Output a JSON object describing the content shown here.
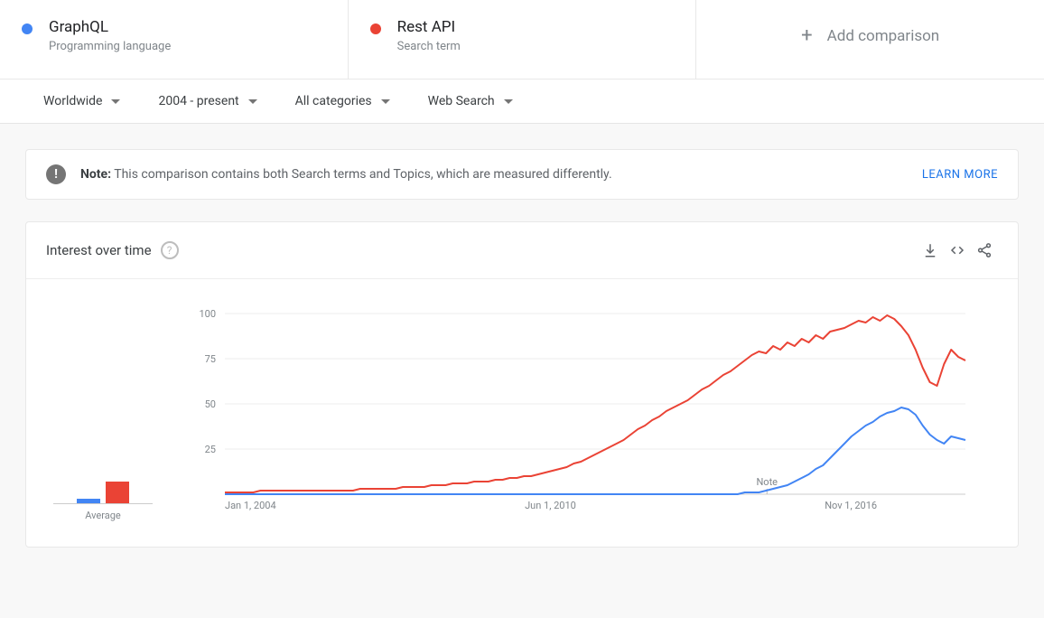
{
  "compare": {
    "items": [
      {
        "name": "GraphQL",
        "sub": "Programming language",
        "color": "#4285f4"
      },
      {
        "name": "Rest API",
        "sub": "Search term",
        "color": "#ea4335"
      }
    ],
    "add_label": "Add comparison"
  },
  "filters": {
    "region": "Worldwide",
    "time": "2004 - present",
    "cat": "All categories",
    "type": "Web Search"
  },
  "note": {
    "prefix": "Note:",
    "text": "This comparison contains both Search terms and Topics, which are measured differently.",
    "learn": "LEARN MORE"
  },
  "chart": {
    "title": "Interest over time",
    "avg_label": "Average"
  },
  "chart_data": {
    "type": "line",
    "title": "Interest over time",
    "ylabel": "",
    "ylim": [
      0,
      100
    ],
    "yticks": [
      25,
      50,
      75,
      100
    ],
    "xticks": [
      "Jan 1, 2004",
      "Jun 1, 2010",
      "Nov 1, 2016"
    ],
    "note_label": "Note",
    "note_x": 0.732,
    "averages": {
      "GraphQL": 8,
      "Rest API": 38
    },
    "series": [
      {
        "name": "GraphQL",
        "color": "#4285f4",
        "values": [
          0,
          0,
          0,
          0,
          0,
          0,
          0,
          0,
          0,
          0,
          0,
          0,
          0,
          0,
          0,
          0,
          0,
          0,
          0,
          0,
          0,
          0,
          0,
          0,
          0,
          0,
          0,
          0,
          0,
          0,
          0,
          0,
          0,
          0,
          0,
          0,
          0,
          0,
          0,
          0,
          0,
          0,
          0,
          0,
          0,
          0,
          0,
          0,
          0,
          0,
          0,
          0,
          0,
          0,
          0,
          0,
          0,
          0,
          0,
          0,
          0,
          0,
          0,
          0,
          0,
          0,
          0,
          0,
          0,
          0,
          0,
          0,
          0,
          1,
          1,
          1,
          2,
          3,
          4,
          5,
          7,
          9,
          11,
          14,
          16,
          20,
          24,
          28,
          32,
          35,
          38,
          40,
          43,
          45,
          46,
          48,
          47,
          44,
          38,
          33,
          30,
          28,
          32,
          31,
          30
        ]
      },
      {
        "name": "Rest API",
        "color": "#ea4335",
        "values": [
          1,
          1,
          1,
          1,
          1,
          2,
          2,
          2,
          2,
          2,
          2,
          2,
          2,
          2,
          2,
          2,
          2,
          2,
          2,
          3,
          3,
          3,
          3,
          3,
          3,
          4,
          4,
          4,
          4,
          5,
          5,
          5,
          6,
          6,
          6,
          7,
          7,
          7,
          8,
          8,
          9,
          9,
          10,
          10,
          11,
          12,
          13,
          14,
          15,
          17,
          18,
          20,
          22,
          24,
          26,
          28,
          30,
          33,
          36,
          38,
          41,
          43,
          46,
          48,
          50,
          52,
          55,
          58,
          60,
          63,
          66,
          68,
          71,
          74,
          77,
          79,
          78,
          82,
          80,
          84,
          82,
          86,
          84,
          88,
          86,
          90,
          91,
          92,
          94,
          96,
          95,
          98,
          96,
          99,
          97,
          93,
          88,
          80,
          70,
          62,
          60,
          72,
          80,
          76,
          74
        ]
      }
    ]
  }
}
